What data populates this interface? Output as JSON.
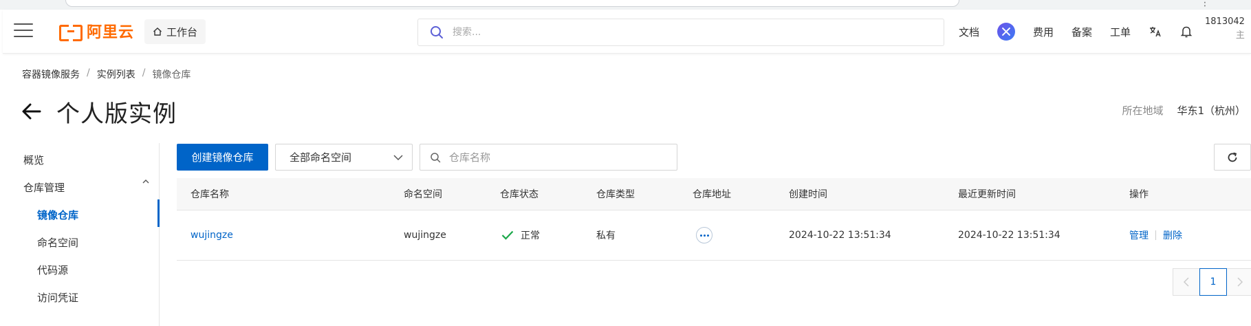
{
  "header": {
    "logo_text": "阿里云",
    "workbench_label": "工作台",
    "search_placeholder": "搜索...",
    "nav": {
      "docs": "文档",
      "fees": "费用",
      "filing": "备案",
      "tickets": "工单"
    },
    "user_id": "1813042",
    "user_sub": "主"
  },
  "breadcrumb": {
    "items": [
      "容器镜像服务",
      "实例列表",
      "镜像仓库"
    ],
    "sep": "/"
  },
  "page": {
    "title": "个人版实例",
    "region_label": "所在地域",
    "region_value": "华东1（杭州）"
  },
  "sidebar": {
    "overview": "概览",
    "repo_mgmt": "仓库管理",
    "items": [
      "镜像仓库",
      "命名空间",
      "代码源",
      "访问凭证"
    ]
  },
  "toolbar": {
    "create_label": "创建镜像仓库",
    "namespace_selected": "全部命名空间",
    "repo_search_placeholder": "仓库名称"
  },
  "table": {
    "headers": [
      "仓库名称",
      "命名空间",
      "仓库状态",
      "仓库类型",
      "仓库地址",
      "创建时间",
      "最近更新时间",
      "操作"
    ],
    "rows": [
      {
        "name": "wujingze",
        "namespace": "wujingze",
        "status": "正常",
        "type": "私有",
        "created": "2024-10-22 13:51:34",
        "updated": "2024-10-22 13:51:34",
        "op_manage": "管理",
        "op_delete": "删除"
      }
    ]
  },
  "pagination": {
    "current": "1"
  },
  "colors": {
    "brand": "#ff6a00",
    "primary": "#0064c8",
    "success": "#1ba84a"
  }
}
